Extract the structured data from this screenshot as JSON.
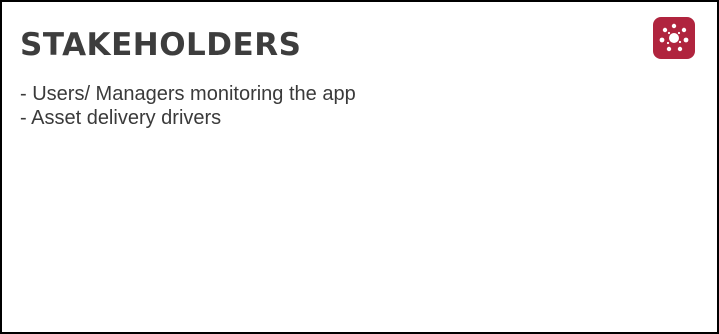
{
  "slide": {
    "title": "STAKEHOLDERS",
    "bullets": [
      "- Users/ Managers monitoring the app",
      "- Asset delivery drivers"
    ]
  },
  "colors": {
    "logo_background": "#b0243e",
    "logo_foreground": "#ffffff",
    "text": "#3a3a3a",
    "border": "#000000"
  },
  "icons": {
    "logo": "app-logo-icon"
  }
}
